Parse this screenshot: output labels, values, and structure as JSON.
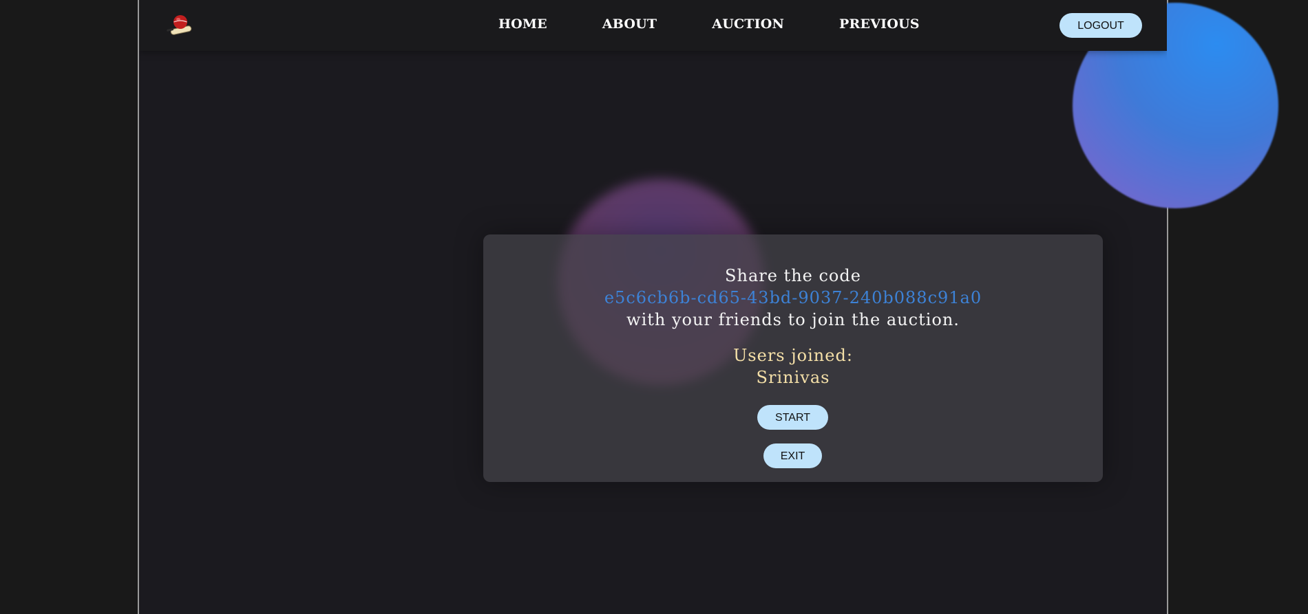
{
  "navbar": {
    "logo_icon": "cricket-ball-bat-icon",
    "links": [
      {
        "label": "HOME"
      },
      {
        "label": "ABOUT"
      },
      {
        "label": "AUCTION"
      },
      {
        "label": "PREVIOUS"
      }
    ],
    "logout_label": "LOGOUT"
  },
  "card": {
    "share_title": "Share the code",
    "share_code": "e5c6cb6b-cd65-43bd-9037-240b088c91a0",
    "share_sub": "with your friends to join the auction.",
    "users_label": "Users joined:",
    "users": [
      "Srinivas"
    ],
    "start_label": "START",
    "exit_label": "EXIT"
  },
  "colors": {
    "background": "#191919",
    "panel": "#1b1a1f",
    "button": "#bfe3fb",
    "code_text": "#3d82d6",
    "users_text": "#f5e0a8"
  }
}
